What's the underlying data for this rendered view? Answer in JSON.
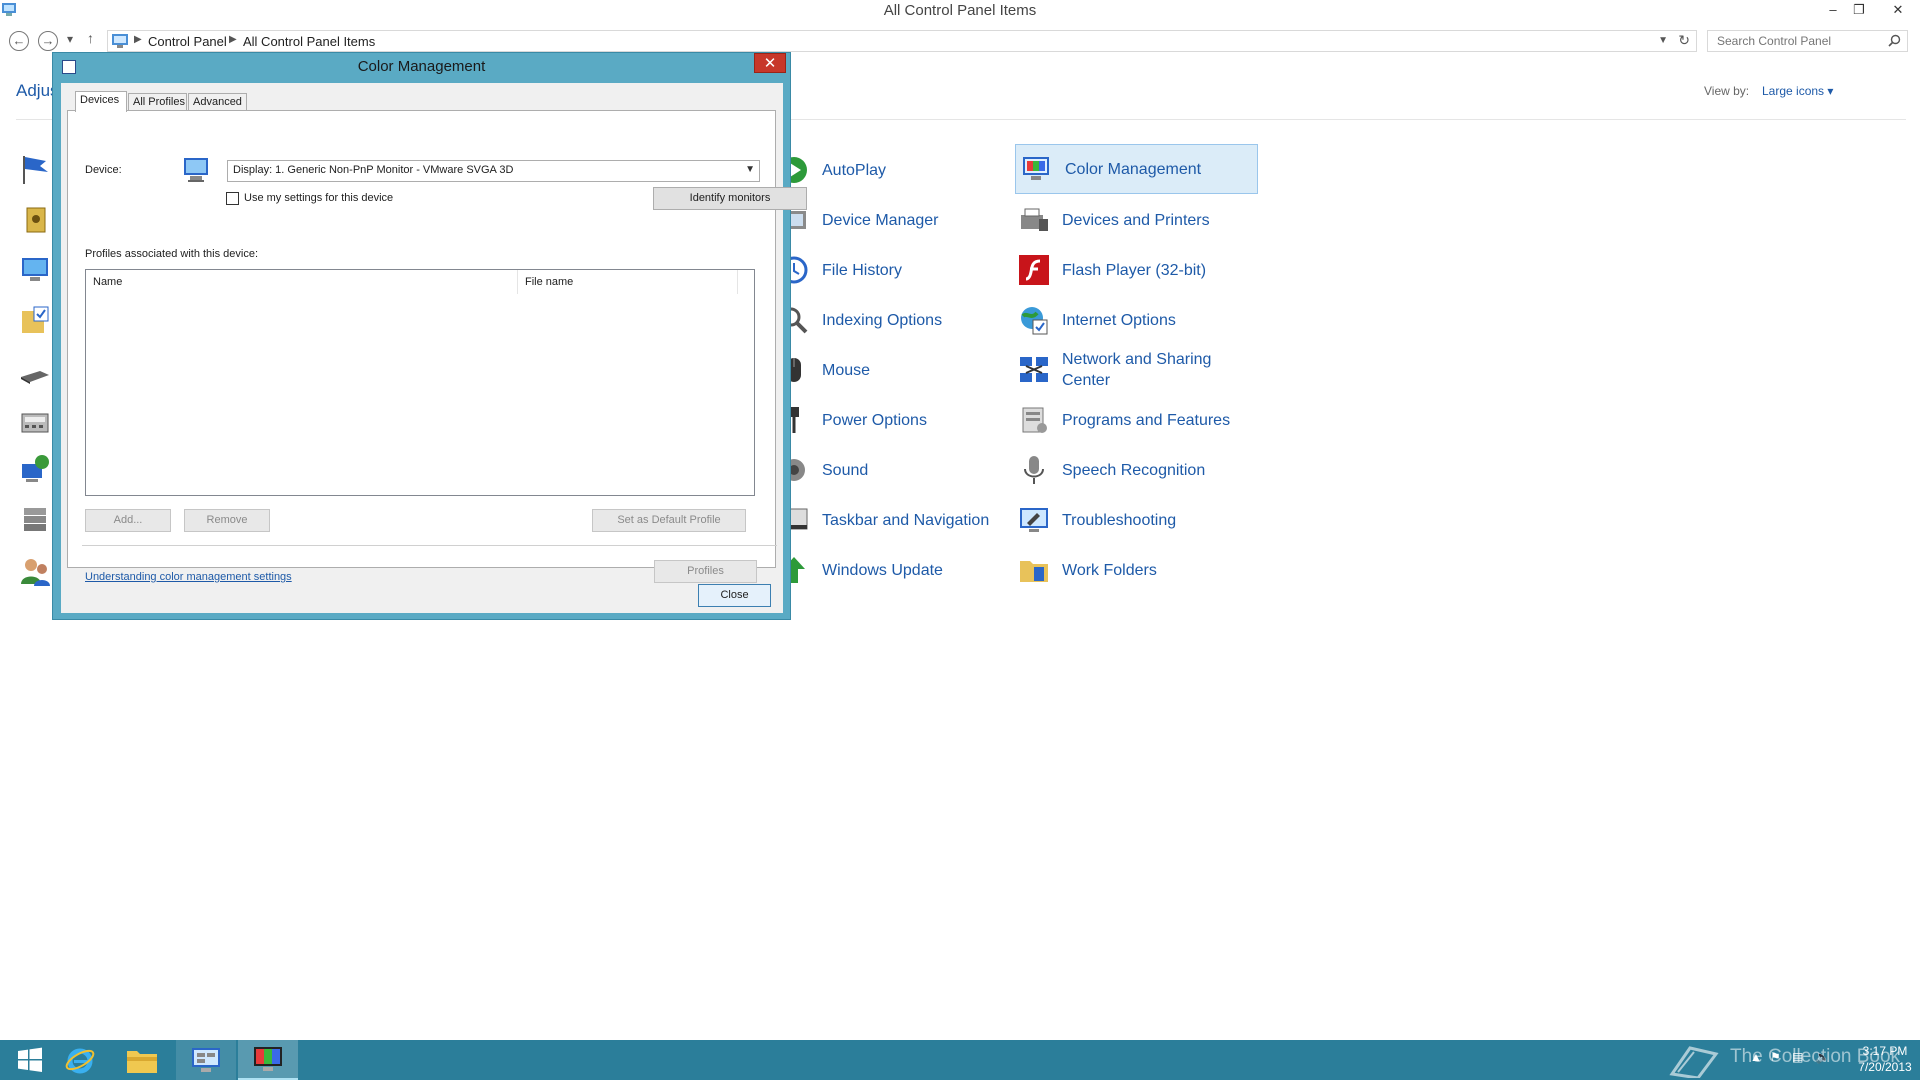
{
  "window": {
    "title": "All Control Panel Items",
    "minimize": "‒",
    "restore": "❐",
    "close": "✕"
  },
  "address": {
    "crumbs": [
      "Control Panel",
      "All Control Panel Items"
    ],
    "separator": "▶",
    "search_placeholder": "Search Control Panel"
  },
  "main": {
    "heading": "Adjus",
    "view_by_label": "View by:",
    "view_by_value": "Large icons ▾"
  },
  "items_col1": [
    "AutoPlay",
    "Device Manager",
    "File History",
    "Indexing Options",
    "Mouse",
    "Power Options",
    "Sound",
    "Taskbar and Navigation",
    "Windows Update"
  ],
  "items_col2": [
    "Color Management",
    "Devices and Printers",
    "Flash Player (32-bit)",
    "Internet Options",
    "Network and Sharing Center",
    "Programs and Features",
    "Speech Recognition",
    "Troubleshooting",
    "Work Folders"
  ],
  "selected_item": "Color Management",
  "dialog": {
    "title": "Color Management",
    "close_glyph": "✕",
    "tabs": [
      "Devices",
      "All Profiles",
      "Advanced"
    ],
    "active_tab": "Devices",
    "device_label": "Device:",
    "device_value": "Display: 1. Generic Non-PnP Monitor - VMware SVGA 3D",
    "use_my_settings": "Use my settings for this device",
    "use_my_settings_checked": false,
    "identify_monitors": "Identify monitors",
    "profiles_label": "Profiles associated with this device:",
    "columns": [
      "Name",
      "File name"
    ],
    "add": "Add...",
    "remove": "Remove",
    "set_default": "Set as Default Profile",
    "link": "Understanding color management settings",
    "profiles_button": "Profiles",
    "close_button": "Close"
  },
  "taskbar": {
    "items": [
      "start",
      "internet-explorer",
      "file-explorer",
      "control-panel",
      "color-management"
    ],
    "time": "3:17 PM",
    "date": "7/20/2013",
    "watermark": "The Collection Book"
  },
  "colors": {
    "accent_link": "#1e5aa8",
    "dialog_frame": "#5aaac4",
    "taskbar": "#2b7e9a",
    "selection": "#dbecf8"
  }
}
